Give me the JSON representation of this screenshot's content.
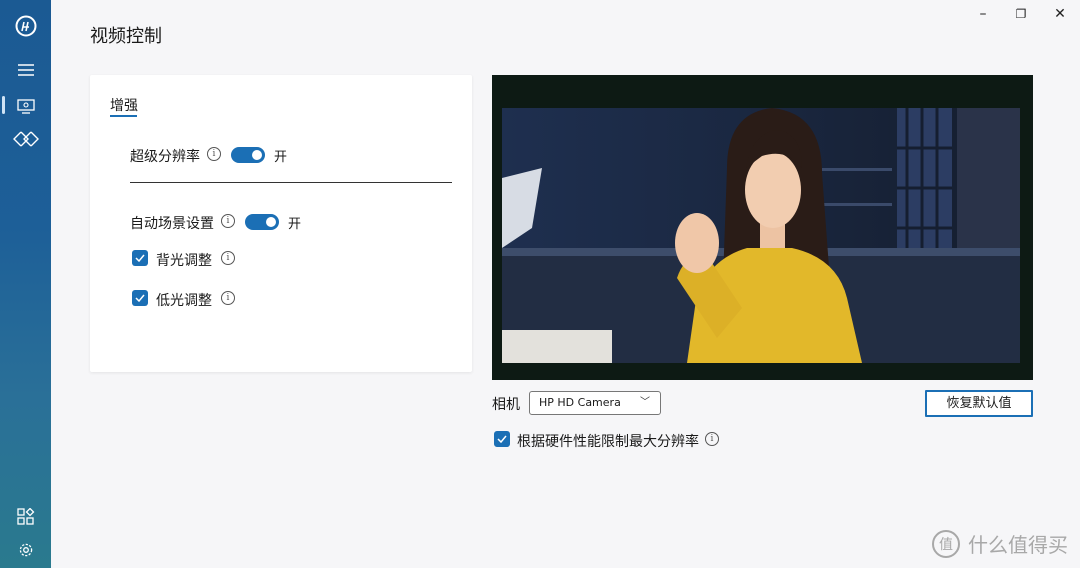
{
  "window": {
    "minimize": "–",
    "maximize": "❐",
    "close": "✕"
  },
  "page_title": "视频控制",
  "sidebar": {
    "items": [
      {
        "icon": "hp-logo-icon"
      },
      {
        "icon": "menu-icon"
      },
      {
        "icon": "monitor-icon",
        "active": true
      },
      {
        "icon": "diamond-arrows-icon"
      },
      {
        "icon": "apps-icon"
      },
      {
        "icon": "settings-icon"
      }
    ]
  },
  "enhance": {
    "tab_label": "增强",
    "super_resolution": {
      "label": "超级分辨率",
      "state": "开"
    },
    "auto_scene": {
      "label": "自动场景设置",
      "state": "开"
    },
    "backlight": {
      "label": "背光调整"
    },
    "lowlight": {
      "label": "低光调整"
    },
    "info_glyph": "i"
  },
  "camera": {
    "label": "相机",
    "selected": "HP HD Camera",
    "reset_label": "恢复默认值",
    "limit_label": "根据硬件性能限制最大分辨率"
  },
  "watermark": {
    "symbol": "值",
    "text": "什么值得买"
  },
  "colors": {
    "accent": "#1b6fb5",
    "sidebar": "#1d5f98",
    "sweater": "#e2b82a"
  }
}
